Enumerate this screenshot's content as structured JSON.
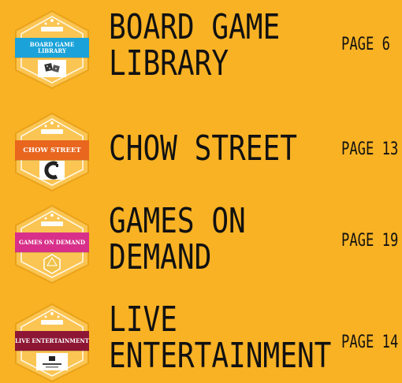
{
  "sections": [
    {
      "badge_label": "BOARD GAME LIBRARY",
      "banner_color": "#1BA3D9",
      "icon": "dice-icon",
      "title_lines": [
        "BOARD GAME",
        "LIBRARY"
      ],
      "page": "PAGE 6"
    },
    {
      "badge_label": "CHOW STREET",
      "banner_color": "#E8661E",
      "icon": "chow-street-logo-icon",
      "title_lines": [
        "CHOW STREET"
      ],
      "page": "PAGE 13"
    },
    {
      "badge_label": "GAMES ON DEMAND",
      "banner_color": "#D8308A",
      "icon": "d20-die-icon",
      "title_lines": [
        "GAMES ON",
        "DEMAND"
      ],
      "page": "PAGE 19"
    },
    {
      "badge_label": "LIVE ENTERTAINMENT",
      "banner_color": "#8E1635",
      "icon": "honey-badger-logo-icon",
      "title_lines": [
        "LIVE",
        "ENTERTAINMENT"
      ],
      "page": "PAGE 14"
    }
  ]
}
